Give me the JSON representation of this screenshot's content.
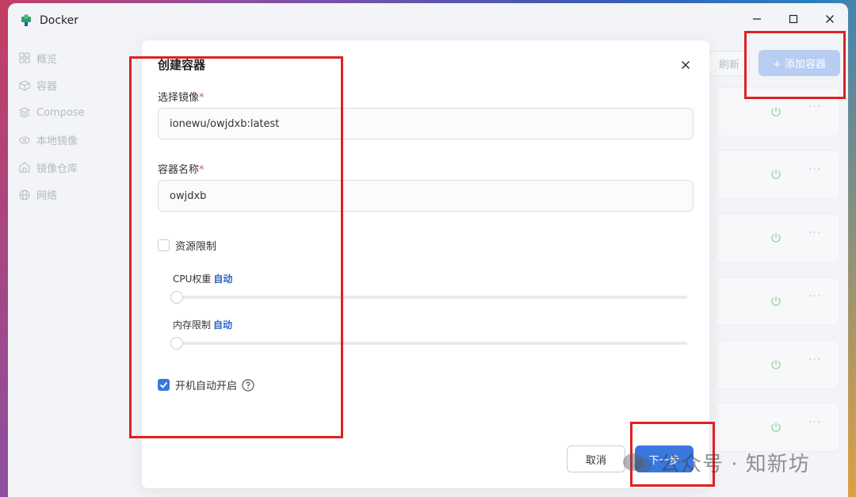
{
  "window": {
    "title": "Docker",
    "icons": {
      "app": "docker-icon",
      "minimize": "minimize-icon",
      "maximize": "maximize-icon",
      "close": "close-icon"
    }
  },
  "sidebar": {
    "items": [
      {
        "label": "概览",
        "icon": "overview-grid-icon"
      },
      {
        "label": "容器",
        "icon": "container-cube-icon"
      },
      {
        "label": "Compose",
        "icon": "layers-icon"
      },
      {
        "label": "本地镜像",
        "icon": "disc-icon"
      },
      {
        "label": "镜像仓库",
        "icon": "warehouse-icon"
      },
      {
        "label": "网络",
        "icon": "globe-icon"
      }
    ]
  },
  "toolbar": {
    "refresh_label": "刷新",
    "add_container_label": "+ 添加容器"
  },
  "modal": {
    "title": "创建容器",
    "image": {
      "label": "选择镜像",
      "required_mark": "*",
      "value": "ionewu/owjdxb:latest"
    },
    "name": {
      "label": "容器名称",
      "required_mark": "*",
      "value": "owjdxb"
    },
    "resource_limit": {
      "label": "资源限制",
      "checked": false
    },
    "cpu": {
      "label": "CPU权重",
      "mode": "自动",
      "level": 0
    },
    "memory": {
      "label": "内存限制",
      "mode": "自动",
      "level": 0
    },
    "autostart": {
      "label": "开机自动开启",
      "checked": true,
      "help_icon": "question-circle-icon"
    },
    "cancel_label": "取消",
    "next_label": "下一步"
  },
  "watermark": {
    "text": "公众号 · 知新坊"
  },
  "colors": {
    "accent": "#3a78e0",
    "annotation": "#e02020",
    "auto_text": "#2a62c9",
    "power_icon": "#9ed9a9"
  }
}
